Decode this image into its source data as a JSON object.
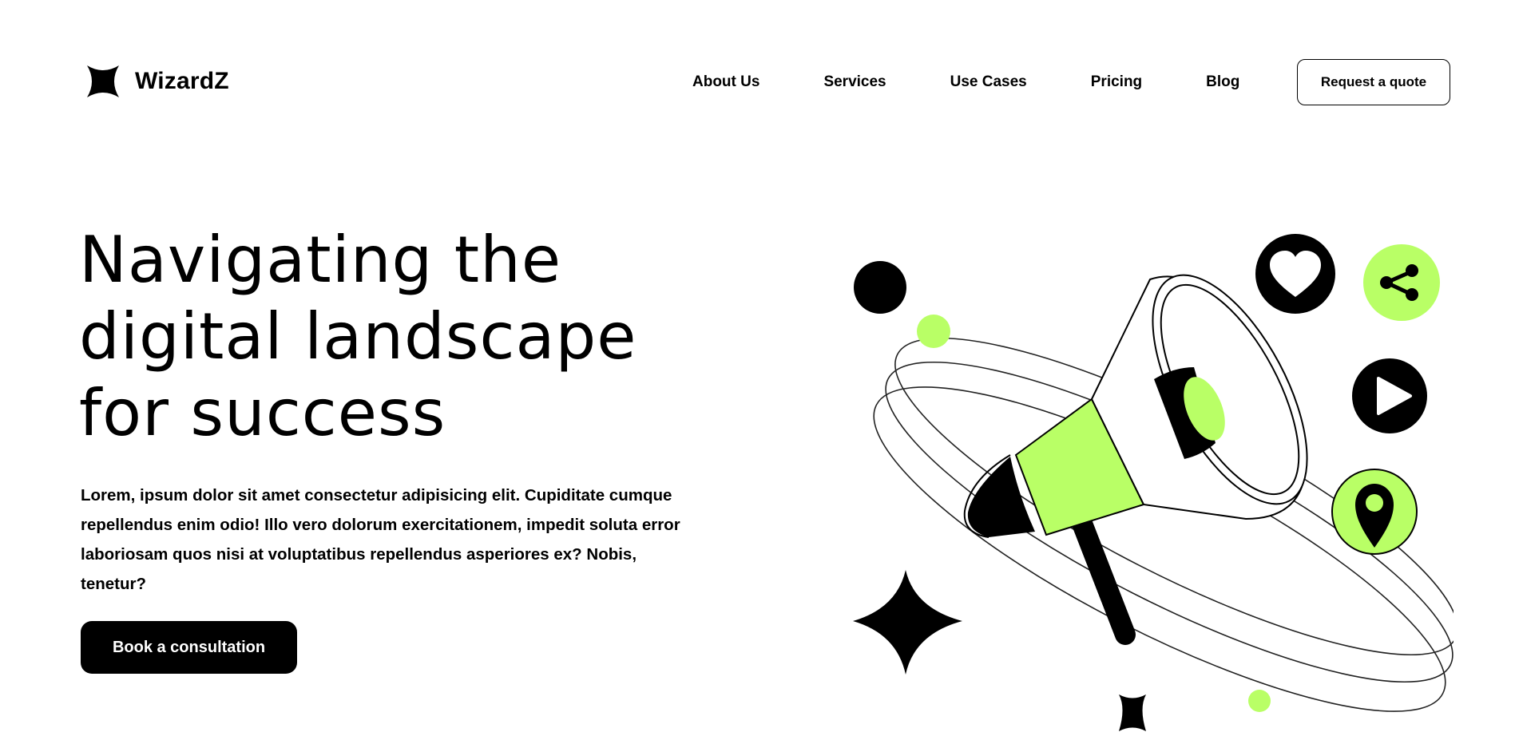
{
  "brand": {
    "name": "WizardZ",
    "logo_icon": "four-point-star-icon"
  },
  "nav": {
    "items": [
      {
        "label": "About Us"
      },
      {
        "label": "Services"
      },
      {
        "label": "Use Cases"
      },
      {
        "label": "Pricing"
      },
      {
        "label": "Blog"
      }
    ],
    "cta_label": "Request a quote"
  },
  "hero": {
    "title_lines": [
      "Navigating the",
      "digital landscape",
      "for success"
    ],
    "description": "Lorem, ipsum dolor sit amet consectetur adipisicing elit. Cupiditate cumque repellendus enim odio! Illo vero dolorum exercitationem, impedit soluta error laboriosam quos nisi at voluptatibus repellendus asperiores ex? Nobis, tenetur?",
    "cta_label": "Book a consultation"
  },
  "illustration": {
    "main_icon": "megaphone-icon",
    "badges": [
      "heart-icon",
      "share-icon",
      "play-icon",
      "location-pin-icon"
    ],
    "decorations": [
      "sparkle-star-icon",
      "four-point-star-icon"
    ]
  },
  "colors": {
    "accent": "#B9FF66",
    "dark": "#000000",
    "background": "#FFFFFF"
  }
}
